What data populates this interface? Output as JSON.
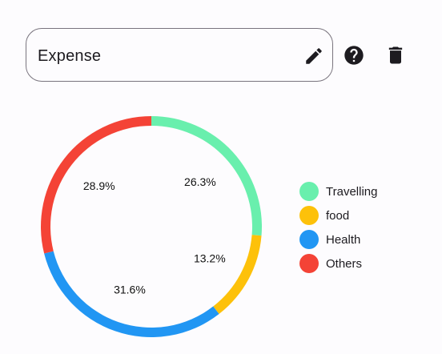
{
  "form": {
    "title_value": "Expense"
  },
  "icons": {
    "edit": "pencil-icon",
    "help": "help-circle-icon",
    "delete": "trash-icon"
  },
  "chart_data": {
    "type": "pie",
    "style": "donut",
    "categories": [
      "Travelling",
      "food",
      "Health",
      "Others"
    ],
    "values": [
      26.3,
      13.2,
      31.6,
      28.9
    ],
    "labels": [
      "26.3%",
      "13.2%",
      "31.6%",
      "28.9%"
    ],
    "colors": [
      "#69efad",
      "#fdc10a",
      "#2196f3",
      "#f44336"
    ],
    "legend_position": "right"
  }
}
